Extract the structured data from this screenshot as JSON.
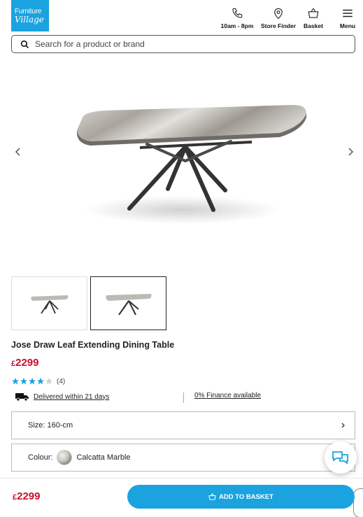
{
  "header": {
    "logo_line1": "Furniture",
    "logo_line2": "Village",
    "hours_label": "10am - 8pm",
    "store_finder_label": "Store Finder",
    "basket_label": "Basket",
    "menu_label": "Menu"
  },
  "search": {
    "placeholder": "Search for a product or brand"
  },
  "product": {
    "title": "Jose Draw Leaf Extending Dining Table",
    "price_currency": "£",
    "price_value": "2299",
    "rating": 4,
    "rating_max": 5,
    "review_count": "(4)",
    "delivery_text": "Delivered within 21 days",
    "finance_text": "0% Finance available"
  },
  "options": {
    "size_label": "Size:",
    "size_value": "160-cm",
    "colour_label": "Colour:",
    "colour_value": "Calcatta Marble"
  },
  "footer": {
    "price_currency": "£",
    "price_value": "2299",
    "add_to_basket_label": "ADD TO BASKET"
  },
  "colors": {
    "brand_blue": "#1ba3df",
    "price_red": "#c8102e",
    "star_blue": "#1ba3df"
  },
  "icons": [
    "phone-icon",
    "location-pin-icon",
    "basket-icon",
    "menu-icon",
    "search-icon",
    "chevron-left-icon",
    "chevron-right-icon",
    "star-icon",
    "delivery-truck-icon",
    "chat-icon"
  ]
}
